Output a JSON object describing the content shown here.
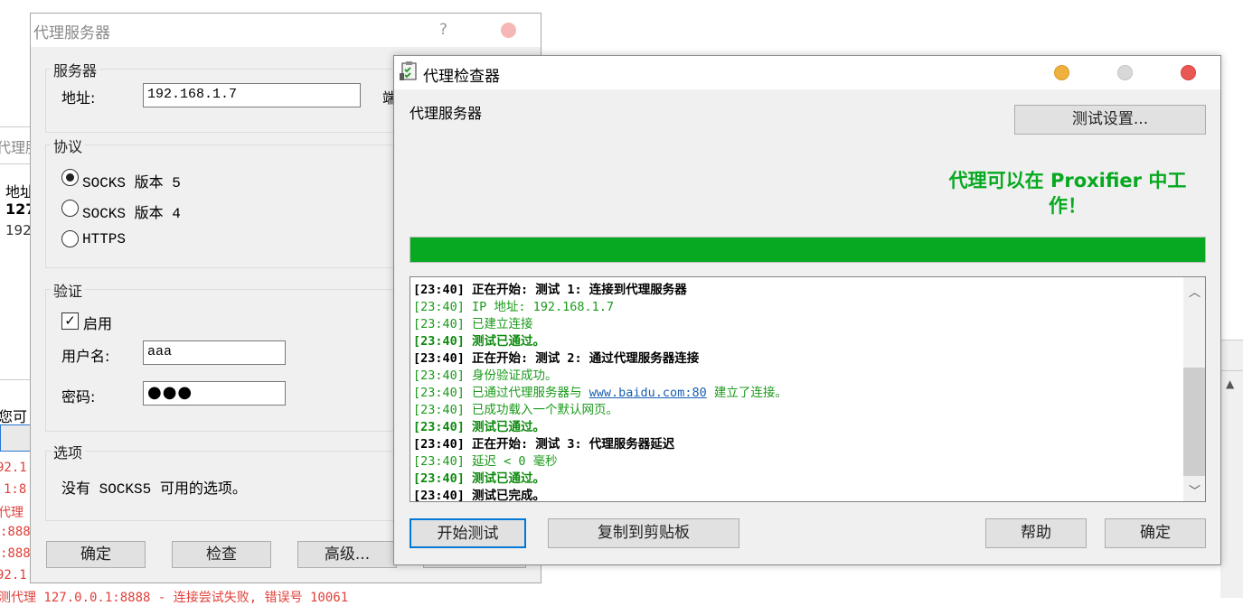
{
  "background": {
    "title_fragment": "代理服",
    "col_fragment": "地址",
    "row1": "127",
    "row2": "192",
    "hint_fragment": "您可",
    "log_lines": [
      "92.1",
      "1:8",
      "代理",
      ":888",
      ":888",
      "92.1",
      "测代理 127.0.0.1:8888 - 连接尝试失败, 错误号 10061"
    ]
  },
  "proxy_dialog": {
    "title": "代理服务器",
    "help_glyph": "?",
    "server_group": "服务器",
    "address_label": "地址:",
    "address_value": "192.168.1.7",
    "port_label_fragment": "端",
    "protocol_group": "协议",
    "protocol_options": [
      "SOCKS 版本 5",
      "SOCKS 版本 4",
      "HTTPS"
    ],
    "auth_group": "验证",
    "auth_enable_label": "启用",
    "username_label": "用户名:",
    "username_value": "aaa",
    "password_label": "密码:",
    "password_mask": "●●●",
    "options_group": "选项",
    "options_text": "没有 SOCKS5 可用的选项。",
    "buttons": {
      "ok": "确定",
      "check": "检查",
      "advanced": "高级..."
    }
  },
  "checker": {
    "title": "代理检查器",
    "section_label": "代理服务器",
    "test_settings_button": "测试设置...",
    "status_message": "代理可以在 Proxifier 中工作！",
    "status_line1": "代理可以在 Proxifier 中工",
    "status_line2": "作！",
    "progress_percent": 100,
    "progress_color": "#06a91f",
    "log": [
      {
        "style": "bk",
        "text": "[23:40] 正在开始: 测试 1: 连接到代理服务器"
      },
      {
        "style": "g",
        "text": "[23:40] IP 地址: 192.168.1.7"
      },
      {
        "style": "g",
        "text": "[23:40] 已建立连接"
      },
      {
        "style": "gb",
        "text": "[23:40] 测试已通过。"
      },
      {
        "style": "bk",
        "text": "[23:40] 正在开始: 测试 2: 通过代理服务器连接"
      },
      {
        "style": "g",
        "text": "[23:40] 身份验证成功。"
      },
      {
        "style": "g",
        "text": "[23:40] 已通过代理服务器与 ",
        "link": "www.baidu.com:80",
        "after": " 建立了连接。"
      },
      {
        "style": "g",
        "text": "[23:40] 已成功载入一个默认网页。"
      },
      {
        "style": "gb",
        "text": "[23:40] 测试已通过。"
      },
      {
        "style": "bk",
        "text": "[23:40] 正在开始: 测试 3: 代理服务器延迟"
      },
      {
        "style": "g",
        "text": "[23:40] 延迟 < 0 毫秒"
      },
      {
        "style": "gb",
        "text": "[23:40] 测试已通过。"
      },
      {
        "style": "bk",
        "text": "[23:40] 测试已完成。"
      }
    ],
    "buttons": {
      "start": "开始测试",
      "copy": "复制到剪贴板",
      "help": "帮助",
      "ok": "确定"
    },
    "window_dots": {
      "minimize": "#f0b03d",
      "maximize": "#d8d8d8",
      "close": "#eb5753"
    }
  }
}
